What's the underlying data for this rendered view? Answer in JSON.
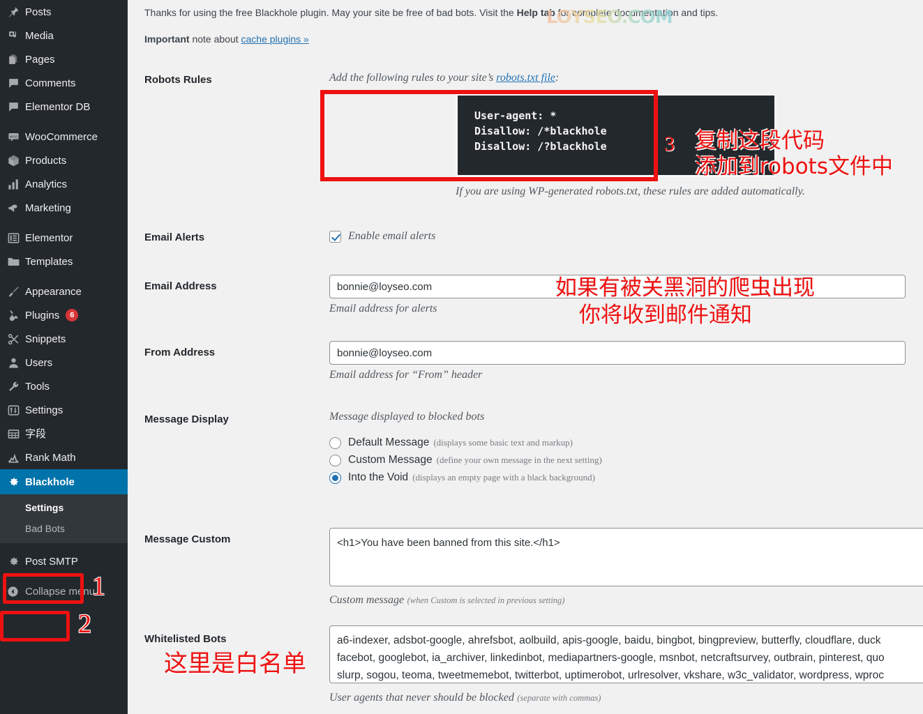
{
  "sidebar": {
    "items": [
      {
        "label": "Posts",
        "icon": "pin-icon",
        "gap_after": false
      },
      {
        "label": "Media",
        "icon": "media-icon",
        "gap_after": false
      },
      {
        "label": "Pages",
        "icon": "pages-icon",
        "gap_after": false
      },
      {
        "label": "Comments",
        "icon": "comments-icon",
        "gap_after": false
      },
      {
        "label": "Elementor DB",
        "icon": "comments-icon",
        "gap_after": true
      },
      {
        "label": "WooCommerce",
        "icon": "woo-icon",
        "gap_after": false
      },
      {
        "label": "Products",
        "icon": "box-icon",
        "gap_after": false
      },
      {
        "label": "Analytics",
        "icon": "bar-chart-icon",
        "gap_after": false
      },
      {
        "label": "Marketing",
        "icon": "megaphone-icon",
        "gap_after": true
      },
      {
        "label": "Elementor",
        "icon": "elementor-icon",
        "gap_after": false
      },
      {
        "label": "Templates",
        "icon": "folder-icon",
        "gap_after": true
      },
      {
        "label": "Appearance",
        "icon": "paintbrush-icon",
        "gap_after": false
      },
      {
        "label": "Plugins",
        "icon": "plug-icon",
        "badge": "6",
        "gap_after": false
      },
      {
        "label": "Snippets",
        "icon": "scissors-icon",
        "gap_after": false
      },
      {
        "label": "Users",
        "icon": "user-icon",
        "gap_after": false
      },
      {
        "label": "Tools",
        "icon": "wrench-icon",
        "gap_after": false
      },
      {
        "label": "Settings",
        "icon": "sliders-icon",
        "gap_after": false
      },
      {
        "label": "字段",
        "icon": "table-icon",
        "gap_after": false
      },
      {
        "label": "Rank Math",
        "icon": "rankmath-icon",
        "gap_after": false
      }
    ],
    "current": {
      "label": "Blackhole",
      "icon": "gear-icon"
    },
    "submenu": [
      {
        "label": "Settings",
        "current": true
      },
      {
        "label": "Bad Bots",
        "current": false
      }
    ],
    "after": [
      {
        "label": "Post SMTP",
        "icon": "gear-icon"
      }
    ],
    "collapse": {
      "label": "Collapse menu",
      "icon": "collapse-icon"
    }
  },
  "notices": {
    "thanks_prefix": "Thanks for using the free Blackhole plugin. May your site be free of bad bots. Visit the ",
    "help_tab": "Help tab",
    "thanks_suffix": " for complete documentation and tips.",
    "important_bold": "Important",
    "important_rest": " note about ",
    "cache_link": "cache plugins »"
  },
  "watermark": "LOYSEO.COM",
  "rows": {
    "robots": {
      "label": "Robots Rules",
      "intro_prefix": "Add the following rules to your site’s ",
      "intro_link": "robots.txt file",
      "intro_suffix": ":",
      "code": "User-agent: *\nDisallow: /*blackhole\nDisallow: /?blackhole",
      "footnote": "If you are using WP-generated robots.txt, these rules are added automatically."
    },
    "email_alerts": {
      "label": "Email Alerts",
      "checkbox_label": "Enable email alerts",
      "checked": true
    },
    "email_address": {
      "label": "Email Address",
      "value": "bonnie@loyseo.com",
      "description": "Email address for alerts"
    },
    "from_address": {
      "label": "From Address",
      "value": "bonnie@loyseo.com",
      "description": "Email address for “From” header"
    },
    "message_display": {
      "label": "Message Display",
      "description": "Message displayed to blocked bots",
      "options": [
        {
          "label": "Default Message",
          "note": "(displays some basic text and markup)",
          "selected": false
        },
        {
          "label": "Custom Message",
          "note": "(define your own message in the next setting)",
          "selected": false
        },
        {
          "label": "Into the Void",
          "note": "(displays an empty page with a black background)",
          "selected": true
        }
      ]
    },
    "message_custom": {
      "label": "Message Custom",
      "value": "<h1>You have been banned from this site.</h1>",
      "description_main": "Custom message",
      "description_note": "(when Custom is selected in previous setting)"
    },
    "whitelisted_bots": {
      "label": "Whitelisted Bots",
      "value": "a6-indexer, adsbot-google, ahrefsbot, aolbuild, apis-google, baidu, bingbot, bingpreview, butterfly, cloudflare, duck\nfacebot, googlebot, ia_archiver, linkedinbot, mediapartners-google, msnbot, netcraftsurvey, outbrain, pinterest, quo\nslurp, sogou, teoma, tweetmemebot, twitterbot, uptimerobot, urlresolver, vkshare, w3c_validator, wordpress, wproc",
      "description_main": "User agents that never should be blocked",
      "description_note": "(separate with commas)"
    }
  },
  "annotations": {
    "step1": "1",
    "step2": "2",
    "step3": "3",
    "code_note_line1": "复制这段代码",
    "code_note_line2": "添加到robots文件中",
    "email_note_line1": "如果有被关黑洞的爬虫出现",
    "email_note_line2": "你将收到邮件通知",
    "whitelist_note": "这里是白名单"
  },
  "colors": {
    "sidebar_bg": "#23282d",
    "submenu_bg": "#32373c",
    "current_menu": "#0073aa",
    "annotation_red": "#ee1111",
    "link_blue": "#2271b1",
    "badge_red": "#d63638",
    "code_bg": "#23282d"
  }
}
